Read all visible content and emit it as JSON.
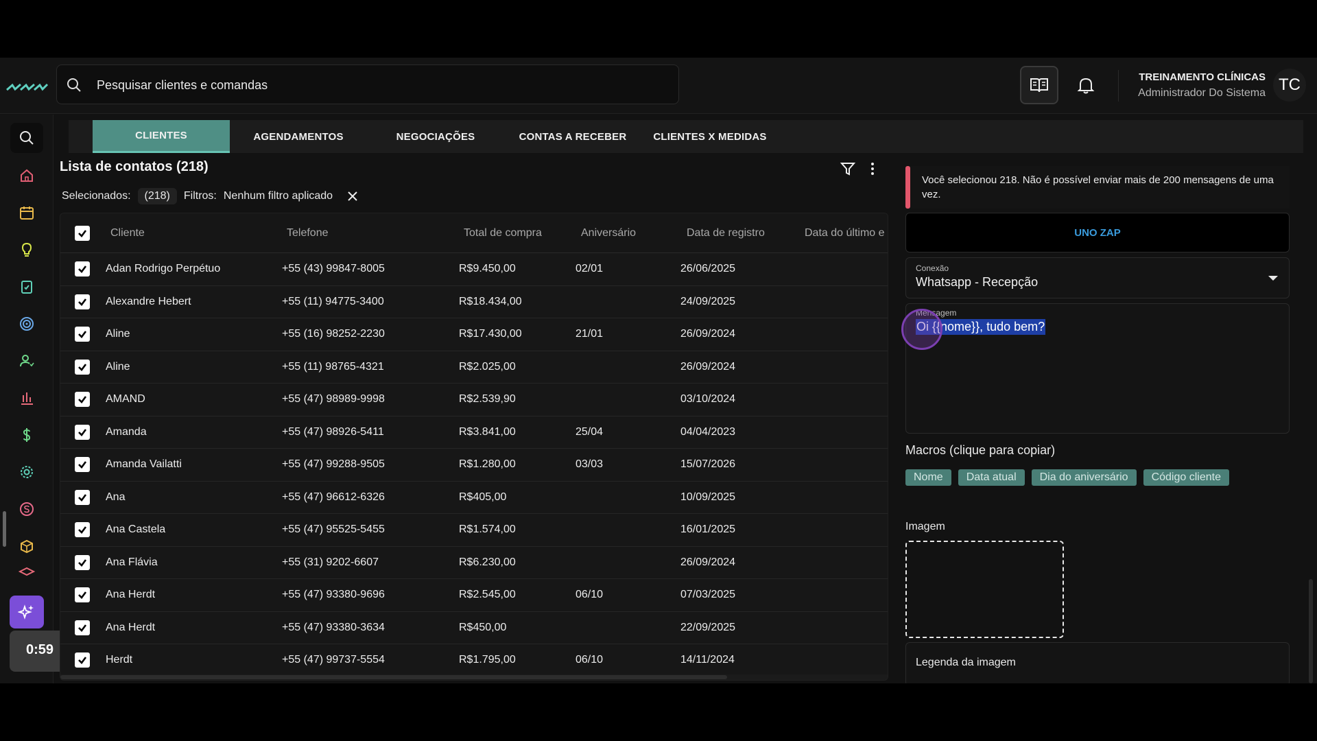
{
  "topbar": {
    "search_placeholder": "Pesquisar clientes e comandas",
    "user_name": "TREINAMENTO CLÍNICAS",
    "user_role": "Administrador Do Sistema",
    "avatar_initials": "TC"
  },
  "tabs": [
    {
      "label": "CLIENTES",
      "active": true
    },
    {
      "label": "AGENDAMENTOS"
    },
    {
      "label": "NEGOCIAÇÕES"
    },
    {
      "label": "CONTAS A RECEBER"
    },
    {
      "label": "CLIENTES X MEDIDAS"
    }
  ],
  "list": {
    "title": "Lista de contatos (218)",
    "selected_label": "Selecionados:",
    "selected_count": "(218)",
    "filters_label": "Filtros:",
    "filters_value": "Nenhum filtro aplicado"
  },
  "table": {
    "columns": [
      "Cliente",
      "Telefone",
      "Total de compra",
      "Aniversário",
      "Data de registro",
      "Data do último e"
    ],
    "rows": [
      {
        "name": "Adan Rodrigo Perpétuo",
        "phone": "+55 (43) 99847-8005",
        "total": "R$9.450,00",
        "birthday": "02/01",
        "registered": "26/06/2025"
      },
      {
        "name": "Alexandre Hebert",
        "phone": "+55 (11) 94775-3400",
        "total": "R$18.434,00",
        "birthday": "",
        "registered": "24/09/2025"
      },
      {
        "name": "Aline",
        "phone": "+55 (16) 98252-2230",
        "total": "R$17.430,00",
        "birthday": "21/01",
        "registered": "26/09/2024"
      },
      {
        "name": "Aline",
        "phone": "+55 (11) 98765-4321",
        "total": "R$2.025,00",
        "birthday": "",
        "registered": "26/09/2024"
      },
      {
        "name": "AMAND",
        "phone": "+55 (47) 98989-9998",
        "total": "R$2.539,90",
        "birthday": "",
        "registered": "03/10/2024"
      },
      {
        "name": "Amanda",
        "phone": "+55 (47) 98926-5411",
        "total": "R$3.841,00",
        "birthday": "25/04",
        "registered": "04/04/2023"
      },
      {
        "name": "Amanda Vailatti",
        "phone": "+55 (47) 99288-9505",
        "total": "R$1.280,00",
        "birthday": "03/03",
        "registered": "15/07/2026"
      },
      {
        "name": "Ana",
        "phone": "+55 (47) 96612-6326",
        "total": "R$405,00",
        "birthday": "",
        "registered": "10/09/2025"
      },
      {
        "name": "Ana Castela",
        "phone": "+55 (47) 95525-5455",
        "total": "R$1.574,00",
        "birthday": "",
        "registered": "16/01/2025"
      },
      {
        "name": "Ana Flávia",
        "phone": "+55 (31) 9202-6607",
        "total": "R$6.230,00",
        "birthday": "",
        "registered": "26/09/2024"
      },
      {
        "name": "Ana Herdt",
        "phone": "+55 (47) 93380-9696",
        "total": "R$2.545,00",
        "birthday": "06/10",
        "registered": "07/03/2025"
      },
      {
        "name": "Ana Herdt",
        "phone": "+55 (47) 93380-3634",
        "total": "R$450,00",
        "birthday": "",
        "registered": "22/09/2025"
      },
      {
        "name": "Herdt",
        "phone": "+55 (47) 99737-5554",
        "total": "R$1.795,00",
        "birthday": "06/10",
        "registered": "14/11/2024"
      }
    ]
  },
  "panel": {
    "alert": "Você selecionou 218. Não é possível enviar mais de 200 mensagens de uma vez.",
    "provider": "UNO ZAP",
    "connection_label": "Conexão",
    "connection_value": "Whatsapp - Recepção",
    "message_label": "Mensagem",
    "message_value": "Oi {{nome}}, tudo bem?",
    "macros_title": "Macros (clique para copiar)",
    "macros": [
      "Nome",
      "Data atual",
      "Dia do aniversário",
      "Código cliente"
    ],
    "image_title": "Imagem",
    "caption_placeholder": "Legenda da imagem"
  },
  "recorder": {
    "time": "0:59"
  },
  "colors": {
    "accent": "#4f8f85",
    "tab_underline": "#67c3b4",
    "alert": "#e2566b",
    "ai": "#7b4ed8",
    "link": "#3a9bdc",
    "chip": "#4a7f77"
  }
}
